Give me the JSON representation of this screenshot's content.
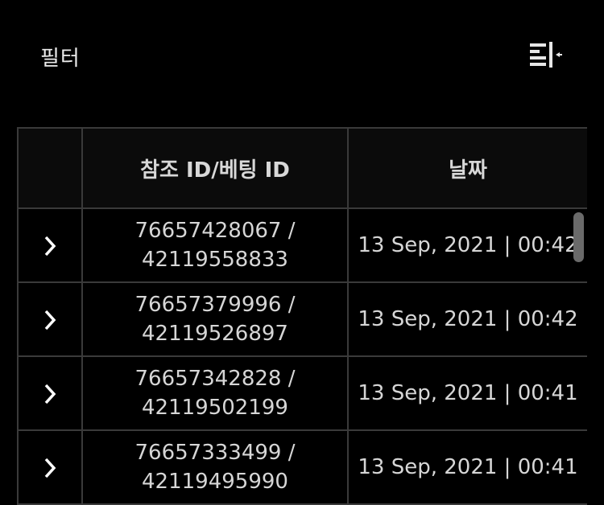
{
  "header": {
    "title": "필터",
    "toggle_icon": "collapse-panel-icon"
  },
  "table": {
    "columns": [
      "",
      "참조 ID/베팅 ID",
      "날짜"
    ],
    "rows": [
      {
        "ref_id": "76657428067 /",
        "bet_id": "42119558833",
        "date": "13 Sep, 2021 | 00:42"
      },
      {
        "ref_id": "76657379996 /",
        "bet_id": "42119526897",
        "date": "13 Sep, 2021 | 00:42"
      },
      {
        "ref_id": "76657342828 /",
        "bet_id": "42119502199",
        "date": "13 Sep, 2021 | 00:41"
      },
      {
        "ref_id": "76657333499 /",
        "bet_id": "42119495990",
        "date": "13 Sep, 2021 | 00:41"
      }
    ],
    "expand_icon": "chevron-right-icon"
  },
  "colors": {
    "background": "#000000",
    "border": "#3a3a3a",
    "header_bg": "#0b0b0b",
    "text": "#d6d6d6",
    "scrollbar": "#6a6a6a"
  }
}
